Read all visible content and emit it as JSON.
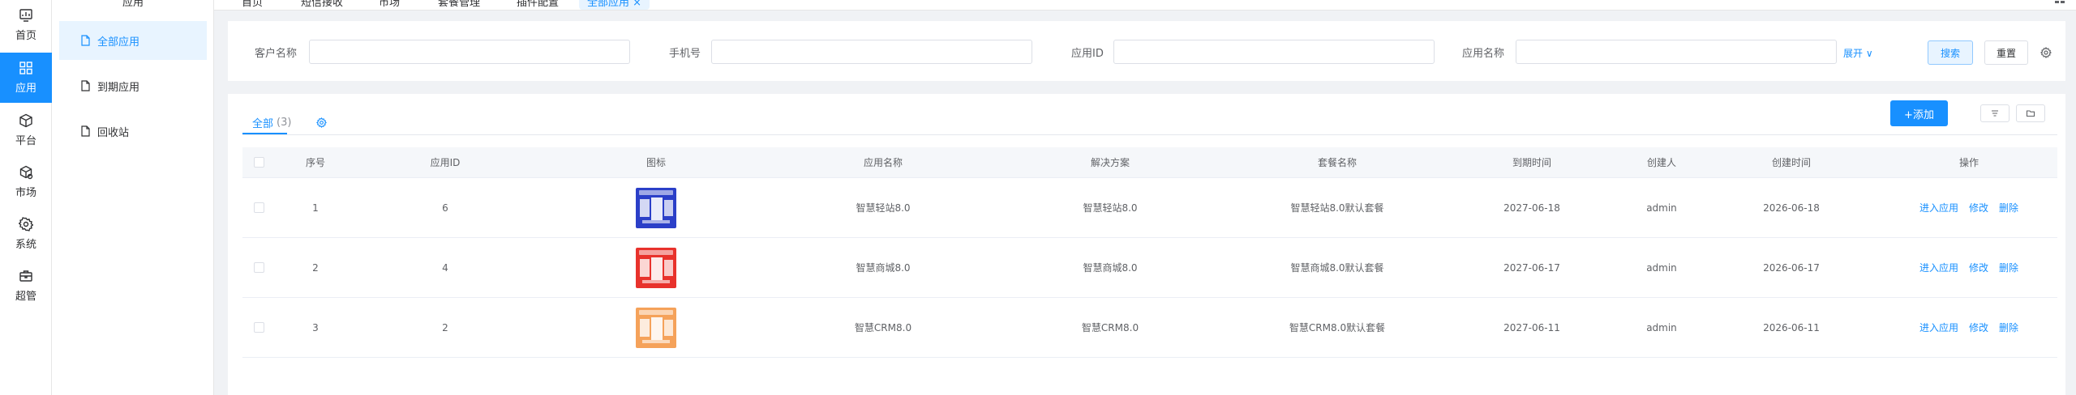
{
  "rail": {
    "items": [
      {
        "label": "首页",
        "icon": "dashboard-icon"
      },
      {
        "label": "应用",
        "icon": "apps-grid-icon",
        "active": true
      },
      {
        "label": "平台",
        "icon": "cube-icon"
      },
      {
        "label": "市场",
        "icon": "market-box-icon"
      },
      {
        "label": "系统",
        "icon": "gear-icon"
      },
      {
        "label": "超管",
        "icon": "briefcase-icon"
      }
    ]
  },
  "subnav": {
    "title": "应用",
    "items": [
      {
        "label": "全部应用",
        "active": true
      },
      {
        "label": "到期应用"
      },
      {
        "label": "回收站"
      }
    ]
  },
  "top_tabs": [
    {
      "label": "首页"
    },
    {
      "label": "短信接收"
    },
    {
      "label": "市场"
    },
    {
      "label": "套餐管理"
    },
    {
      "label": "插件配置"
    },
    {
      "label": "全部应用 ×",
      "active": true
    }
  ],
  "search": {
    "fields": [
      {
        "label": "客户名称",
        "value": "",
        "placeholder": ""
      },
      {
        "label": "手机号",
        "value": "",
        "placeholder": ""
      },
      {
        "label": "应用ID",
        "value": "",
        "placeholder": ""
      },
      {
        "label": "应用名称",
        "value": "",
        "placeholder": ""
      }
    ],
    "expand_label": "展开 ∨",
    "search_button": "搜索",
    "reset_button": "重置"
  },
  "toolbar": {
    "tab_all_label": "全部",
    "tab_all_count": "(3)",
    "add_button": "+添加"
  },
  "table": {
    "columns": [
      "序号",
      "应用ID",
      "图标",
      "应用名称",
      "解决方案",
      "套餐名称",
      "到期时间",
      "创建人",
      "创建时间",
      "操作"
    ],
    "rows": [
      {
        "index": "1",
        "app_id": "6",
        "icon_color": "#2b3fc8",
        "app_name": "智慧轻站8.0",
        "solution": "智慧轻站8.0",
        "package": "智慧轻站8.0默认套餐",
        "expire": "2027-06-18",
        "creator": "admin",
        "created": "2026-06-18"
      },
      {
        "index": "2",
        "app_id": "4",
        "icon_color": "#e8322c",
        "app_name": "智慧商城8.0",
        "solution": "智慧商城8.0",
        "package": "智慧商城8.0默认套餐",
        "expire": "2027-06-17",
        "creator": "admin",
        "created": "2026-06-17"
      },
      {
        "index": "3",
        "app_id": "2",
        "icon_color": "#f5a25a",
        "app_name": "智慧CRM8.0",
        "solution": "智慧CRM8.0",
        "package": "智慧CRM8.0默认套餐",
        "expire": "2027-06-11",
        "creator": "admin",
        "created": "2026-06-11"
      }
    ],
    "actions": {
      "enter": "进入应用",
      "edit": "修改",
      "delete": "删除"
    }
  },
  "colors": {
    "accent": "#1890ff",
    "accent_light": "#e8f4ff",
    "background": "#f0f2f5"
  }
}
